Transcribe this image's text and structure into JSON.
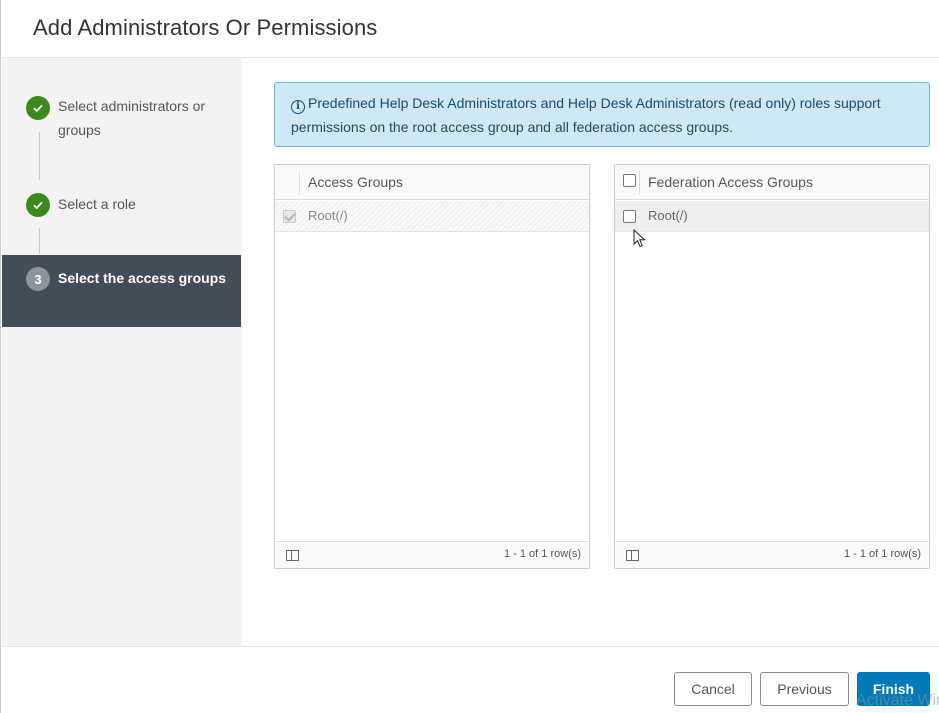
{
  "dialog": {
    "title": "Add Administrators Or Permissions"
  },
  "steps": [
    {
      "label": "Select administrators or groups",
      "state": "done",
      "icon": "check-icon"
    },
    {
      "label": "Select a role",
      "state": "done",
      "icon": "check-icon"
    },
    {
      "number": "3",
      "label": "Select the access groups",
      "state": "active"
    }
  ],
  "alert": {
    "icon": "info-icon",
    "text": "Predefined Help Desk Administrators and Help Desk Administrators (read only) roles support permissions on the root access group and all federation access groups."
  },
  "access_groups": {
    "column_header": "Access Groups",
    "rows": [
      {
        "name": "Root(/)",
        "checked": true,
        "disabled": true
      }
    ],
    "footer_count": "1 - 1 of 1 row(s)"
  },
  "federation_groups": {
    "column_header": "Federation Access Groups",
    "rows": [
      {
        "name": "Root(/)",
        "checked": false
      }
    ],
    "footer_count": "1 - 1 of 1 row(s)"
  },
  "buttons": {
    "cancel": "Cancel",
    "previous": "Previous",
    "finish": "Finish"
  },
  "watermark": "Activate Windows",
  "colors": {
    "step_done": "#3a8a1e",
    "active_step_bg": "#434d57",
    "primary_button": "#0079b8",
    "alert_bg": "#cfe9f4",
    "alert_border": "#67b7dc"
  }
}
